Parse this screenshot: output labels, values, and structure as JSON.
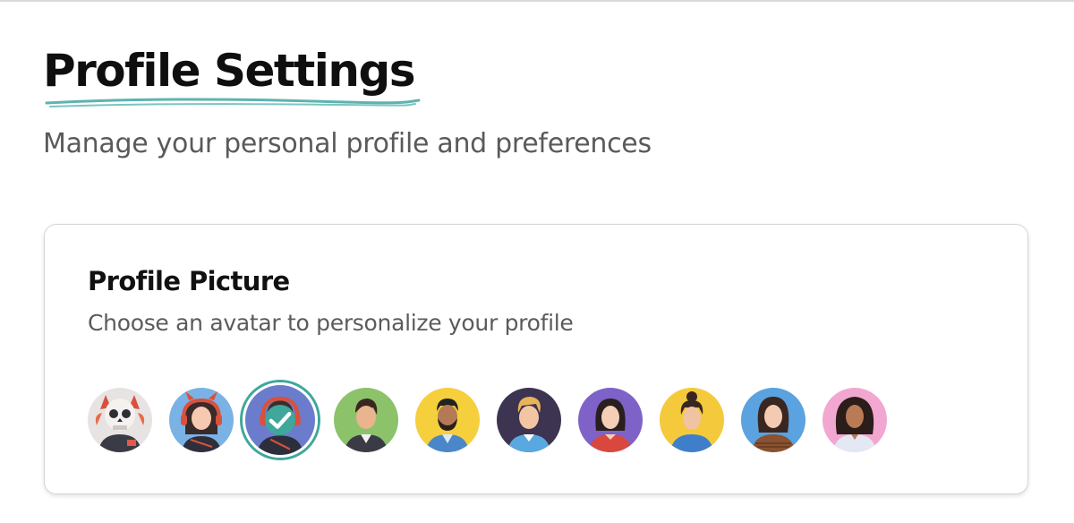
{
  "header": {
    "title": "Profile Settings",
    "subtitle": "Manage your personal profile and preferences",
    "underline_color": "#5fb3b0"
  },
  "profile_picture": {
    "title": "Profile Picture",
    "subtitle": "Choose an avatar to personalize your profile",
    "accent_color": "#3fa79b",
    "selected_index": 2,
    "avatars": [
      {
        "name": "skull-avatar",
        "bg": "#e8e3e3",
        "icon": "skull-icon"
      },
      {
        "name": "gamer-girl-avatar",
        "bg": "#7ab2e6",
        "icon": "headset-girl-icon"
      },
      {
        "name": "gamer-avatar",
        "bg": "#6b7ccc",
        "icon": "headset-person-icon",
        "selected": true
      },
      {
        "name": "man-green-avatar",
        "bg": "#8cc26a",
        "icon": "man-icon"
      },
      {
        "name": "bearded-man-avatar",
        "bg": "#f6cf3d",
        "icon": "bearded-man-icon"
      },
      {
        "name": "blond-man-avatar",
        "bg": "#3c3450",
        "icon": "man-blond-icon"
      },
      {
        "name": "woman-purple-avatar",
        "bg": "#7e62c8",
        "icon": "woman-icon"
      },
      {
        "name": "woman-ponytail-avatar",
        "bg": "#f4c93c",
        "icon": "woman-ponytail-icon"
      },
      {
        "name": "woman-blue-avatar",
        "bg": "#5aa2e0",
        "icon": "woman-long-hair-icon"
      },
      {
        "name": "woman-pink-avatar",
        "bg": "#f2a7d1",
        "icon": "woman-curly-icon"
      }
    ]
  }
}
